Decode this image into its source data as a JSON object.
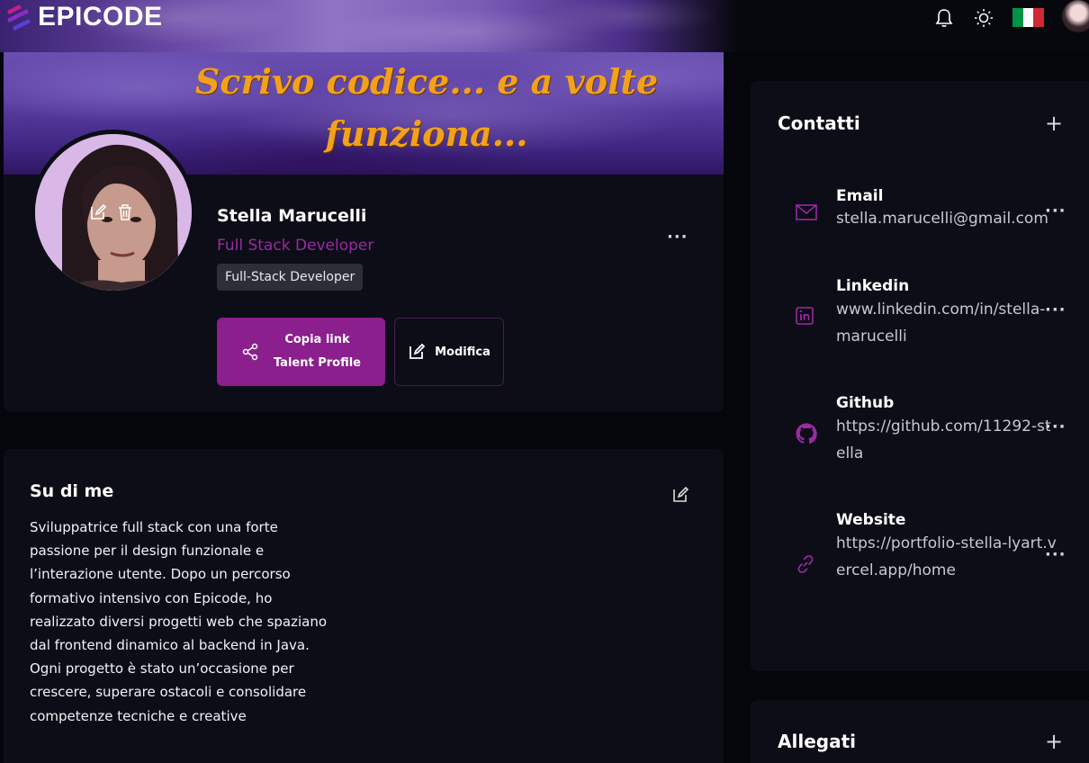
{
  "brand": {
    "name": "EPICODE"
  },
  "topbar": {
    "icons": [
      "bell-icon",
      "sun-icon",
      "italy-flag-icon",
      "user-avatar"
    ],
    "flag_colors": [
      "#009246",
      "#ffffff",
      "#ce2b37"
    ]
  },
  "cover": {
    "line1": "Scrivo codice... e a volte",
    "line2": "funziona..."
  },
  "profile": {
    "name": "Stella Marucelli",
    "role": "Full Stack Developer",
    "tag": "Full-Stack Developer",
    "copy_link_line1": "Copia link",
    "copy_link_line2": "Talent Profile",
    "edit_label": "Modifica",
    "more": "···"
  },
  "about": {
    "title": "Su di me",
    "text": "Sviluppatrice full stack con una forte passione per il design funzionale e l’interazione utente. Dopo un percorso formativo intensivo con Epicode, ho realizzato diversi progetti web che spaziano dal frontend dinamico al backend in Java. Ogni progetto è stato un’occasione per crescere, superare ostacoli e consolidare competenze tecniche e creative"
  },
  "contacts": {
    "title": "Contatti",
    "add": "+",
    "items": [
      {
        "label": "Email",
        "value": "stella.marucelli@gmail.com",
        "icon": "mail-icon",
        "more": "···"
      },
      {
        "label": "Linkedin",
        "value": "www.linkedin.com/in/stella-marucelli",
        "icon": "linkedin-icon",
        "more": "···"
      },
      {
        "label": "Github",
        "value": "https://github.com/11292-stella",
        "icon": "github-icon",
        "more": "···"
      },
      {
        "label": "Website",
        "value": "https://portfolio-stella-lyart.vercel.app/home",
        "icon": "link-icon",
        "more": "···"
      }
    ]
  },
  "allegati": {
    "title": "Allegati",
    "add": "+"
  },
  "colors": {
    "accent": "#8b1f8d",
    "accent_text": "#9b2aa6",
    "cover_text": "#f3a11b",
    "card_bg": "#0c0d16",
    "page_bg": "#05060b"
  }
}
